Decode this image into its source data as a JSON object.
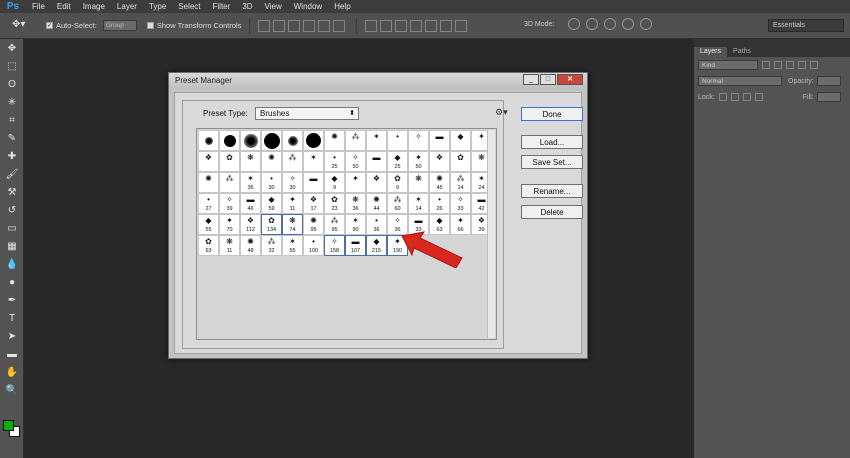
{
  "app": {
    "logo": "Ps"
  },
  "menu": [
    "File",
    "Edit",
    "Image",
    "Layer",
    "Type",
    "Select",
    "Filter",
    "3D",
    "View",
    "Window",
    "Help"
  ],
  "options_bar": {
    "auto_select_label": "Auto-Select:",
    "auto_select_value": "Group",
    "show_transform_label": "Show Transform Controls",
    "mode_3d_label": "3D Mode:",
    "workspace": "Essentials"
  },
  "tools": [
    "move-tool",
    "marquee-tool",
    "lasso-tool",
    "magic-wand-tool",
    "crop-tool",
    "eyedropper-tool",
    "healing-tool",
    "brush-tool",
    "clone-stamp-tool",
    "history-brush-tool",
    "eraser-tool",
    "gradient-tool",
    "blur-tool",
    "dodge-tool",
    "pen-tool",
    "type-tool",
    "path-selection-tool",
    "shape-tool",
    "hand-tool",
    "zoom-tool"
  ],
  "tool_glyphs": [
    "✥",
    "⬚",
    "ʘ",
    "✳",
    "⌗",
    "✎",
    "✚",
    "🖌",
    "⚒",
    "↺",
    "▭",
    "▦",
    "💧",
    "●",
    "✒",
    "T",
    "➤",
    "▬",
    "✋",
    "🔍"
  ],
  "colors": {
    "foreground": "#0bb10b",
    "background": "#ffffff"
  },
  "layers_panel": {
    "tabs": [
      "Layers",
      "Paths"
    ],
    "kind_label": "Kind",
    "blend_mode": "Normal",
    "opacity_label": "Opacity:",
    "lock_label": "Lock:",
    "fill_label": "Fill:"
  },
  "dialog": {
    "title": "Preset Manager",
    "preset_type_label": "Preset Type:",
    "preset_type_value": "Brushes",
    "buttons": {
      "done": "Done",
      "load": "Load...",
      "save_set": "Save Set...",
      "rename": "Rename...",
      "delete": "Delete"
    },
    "window_buttons": {
      "minimize": "_",
      "maximize": "□",
      "close": "✕"
    }
  },
  "brush_grid": {
    "rows": [
      [
        "",
        "",
        "",
        "",
        "",
        "",
        "",
        "",
        "",
        "",
        "",
        "",
        "",
        ""
      ],
      [
        "",
        "",
        "",
        "",
        "",
        "",
        "25",
        "50",
        "",
        "25",
        "50",
        "",
        "",
        ""
      ],
      [
        "",
        "",
        "36",
        "30",
        "30",
        "",
        "9",
        "",
        "",
        "9",
        "",
        "45",
        "14",
        "24"
      ],
      [
        "27",
        "39",
        "46",
        "59",
        "11",
        "17",
        "23",
        "36",
        "44",
        "60",
        "14",
        "26",
        "33",
        "42"
      ],
      [
        "55",
        "70",
        "112",
        "134",
        "74",
        "95",
        "95",
        "90",
        "36",
        "36",
        "33",
        "63",
        "66",
        "39"
      ],
      [
        "63",
        "11",
        "48",
        "32",
        "55",
        "100",
        "158",
        "107",
        "215",
        "190"
      ]
    ]
  }
}
